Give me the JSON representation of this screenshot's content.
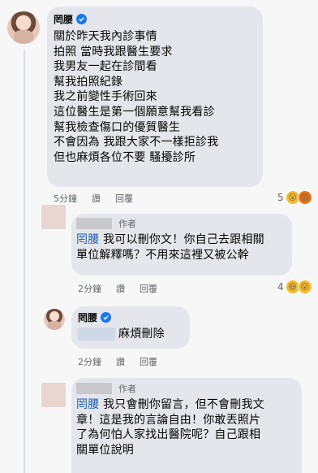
{
  "comments": [
    {
      "name": "罔腰",
      "text": "關於昨天我內診事情\n拍照 當時我跟醫生要求\n我男友一起在診間看\n幫我拍照紀錄\n我之前變性手術回來\n這位醫生是第一個願意幫我看診\n幫我檢查傷口的優質醫生\n不會因為 我跟大家不一樣拒診我\n但也麻煩各位不要 騷擾診所",
      "time": "5分鐘",
      "actions": [
        "讚",
        "回覆"
      ],
      "reaction_count": "5",
      "reactions": [
        "wow",
        "angry"
      ]
    },
    {
      "author_tag": "作者",
      "mention": "罔腰",
      "text": " 我可以刪你文！你自己去跟相關\n單位解釋嗎？不用來這裡又被公幹",
      "time": "2分鐘",
      "actions": [
        "讚",
        "回覆"
      ],
      "reaction_count": "4",
      "reactions": [
        "haha",
        "wow"
      ]
    },
    {
      "name": "罔腰",
      "text": "麻煩刪除",
      "time": "2分鐘",
      "actions": [
        "讚",
        "回覆"
      ]
    },
    {
      "author_tag": "作者",
      "mention": "罔腰",
      "text": " 我只會刪你留言，但不會刪我文\n章！這是我的言論自由！你敢丟照片\n了為何怕人家找出醫院呢？自己跟相\n關單位說明"
    }
  ]
}
